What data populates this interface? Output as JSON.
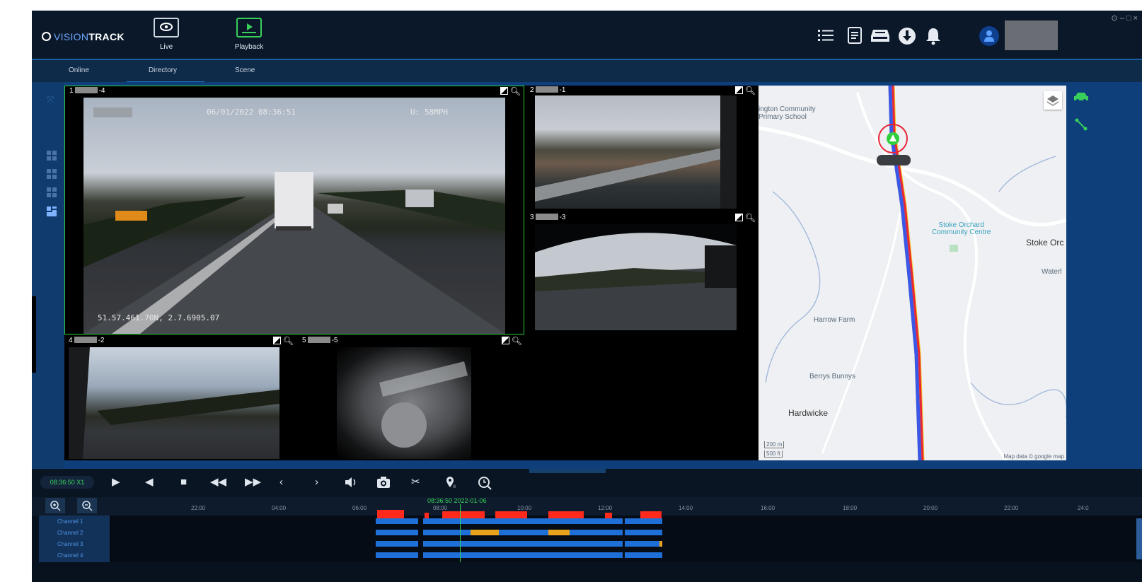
{
  "app": {
    "logo_prefix": "VISION",
    "logo_suffix": "TRACK",
    "window_controls": "⊙ – □ ×"
  },
  "main_nav": [
    {
      "label": "Live",
      "icon": "monitor-eye-icon"
    },
    {
      "label": "Playback",
      "icon": "playback-monitor-icon"
    }
  ],
  "header_icons": [
    "list-icon",
    "report-icon",
    "inbox-icon",
    "download-icon",
    "bell-icon"
  ],
  "sub_nav": {
    "tabs": [
      "Online",
      "Directory",
      "Scene"
    ],
    "active": "Directory"
  },
  "cameras": [
    {
      "index": "1",
      "suffix": "-4",
      "osd_datetime": "06/01/2022 08:36:51",
      "osd_speed": "U: 58MPH",
      "osd_coords": "51.57.461.70N, 2.7.6905.07"
    },
    {
      "index": "2",
      "suffix": "-1"
    },
    {
      "index": "3",
      "suffix": "-3"
    },
    {
      "index": "4",
      "suffix": "-2"
    },
    {
      "index": "5",
      "suffix": "-5"
    }
  ],
  "map": {
    "labels": {
      "school": "ington Community\nPrimary School",
      "community_centre": "Stoke Orchard\nCommunity Centre",
      "stoke": "Stoke Orc",
      "waterl": "Waterl",
      "harrow": "Harrow Farm",
      "berrys": "Berrys Bunnys",
      "hardwicke": "Hardwicke",
      "scale_m": "200 m",
      "scale_ft": "500 ft",
      "credit": "Map data © google map"
    }
  },
  "playback": {
    "time_speed": "08:36:50  X1",
    "buttons": [
      "play-icon",
      "prev-frame-icon",
      "stop-icon",
      "rewind-icon",
      "fast-forward-icon",
      "step-back-icon",
      "step-forward-icon",
      "volume-icon",
      "snapshot-icon",
      "clip-icon",
      "location-pin-icon",
      "search-time-icon"
    ]
  },
  "timeline": {
    "cursor_label": "08:36:50 2022-01-06",
    "ticks": [
      "22:00",
      "04:00",
      "06:00",
      "08:00",
      "10:00",
      "12:00",
      "14:00",
      "16:00",
      "18:00",
      "20:00",
      "22:00",
      "24:0"
    ],
    "channels": [
      "Channel 1",
      "Channel 2",
      "Channel 3",
      "Channel 4"
    ]
  },
  "colors": {
    "accent_green": "#38d05a",
    "track_blue": "#1e6fd8",
    "event_red": "#ff2a1c",
    "route_red": "#e8263a",
    "route_blue": "#3a57e8",
    "route_yellow": "#f5c51a"
  }
}
